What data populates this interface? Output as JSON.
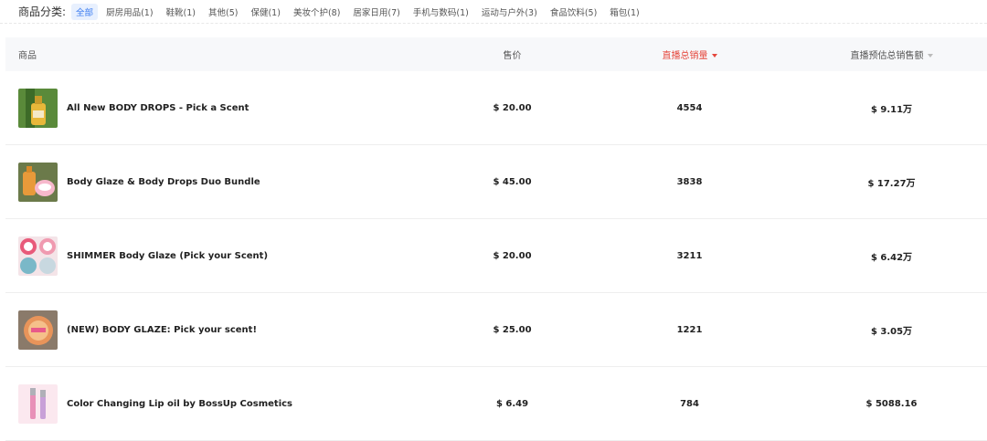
{
  "filters": {
    "label": "商品分类:",
    "chips": [
      "全部",
      "厨房用品(1)",
      "鞋靴(1)",
      "其他(5)",
      "保健(1)",
      "美妆个护(8)",
      "居家日用(7)",
      "手机与数码(1)",
      "运动与户外(3)",
      "食品饮料(5)",
      "箱包(1)"
    ]
  },
  "table": {
    "headers": {
      "product": "商品",
      "price": "售价",
      "sales": "直播总销量",
      "amount": "直播预估总销售额"
    },
    "rows": [
      {
        "name": "All New BODY DROPS - Pick a Scent",
        "price": "$ 20.00",
        "sales": "4554",
        "amount": "$ 9.11万"
      },
      {
        "name": "Body Glaze & Body Drops Duo Bundle",
        "price": "$ 45.00",
        "sales": "3838",
        "amount": "$ 17.27万"
      },
      {
        "name": "SHIMMER Body Glaze (Pick your Scent)",
        "price": "$ 20.00",
        "sales": "3211",
        "amount": "$ 6.42万"
      },
      {
        "name": "(NEW) BODY GLAZE: Pick your scent!",
        "price": "$ 25.00",
        "sales": "1221",
        "amount": "$ 3.05万"
      },
      {
        "name": "Color Changing Lip oil by BossUp Cosmetics",
        "price": "$ 6.49",
        "sales": "784",
        "amount": "$ 5088.16"
      }
    ]
  },
  "colors": {
    "accent": "#3b7cf0",
    "sort_active": "#e5473c"
  }
}
